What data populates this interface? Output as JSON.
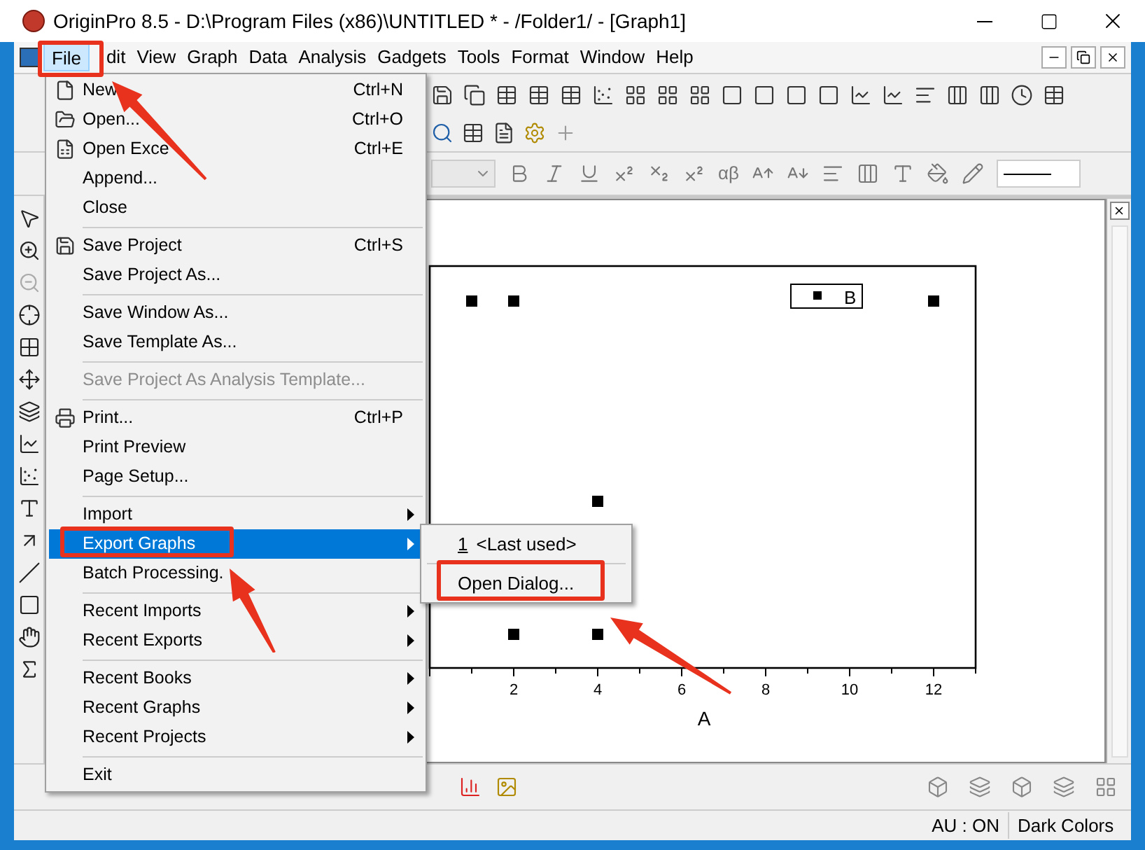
{
  "window": {
    "title": "OriginPro 8.5 - D:\\Program Files (x86)\\UNTITLED * - /Folder1/ - [Graph1]"
  },
  "menubar": [
    {
      "label": "File",
      "selected": true
    },
    {
      "label": "dit",
      "selected": false
    },
    {
      "label": "View",
      "selected": false
    },
    {
      "label": "Graph",
      "selected": false
    },
    {
      "label": "Data",
      "selected": false
    },
    {
      "label": "Analysis",
      "selected": false
    },
    {
      "label": "Gadgets",
      "selected": false
    },
    {
      "label": "Tools",
      "selected": false
    },
    {
      "label": "Format",
      "selected": false
    },
    {
      "label": "Window",
      "selected": false
    },
    {
      "label": "Help",
      "selected": false
    }
  ],
  "file_menu": [
    {
      "kind": "item",
      "label": "New",
      "shortcut": "Ctrl+N",
      "disabled": false,
      "has_submenu": false,
      "selected": false
    },
    {
      "kind": "item",
      "label": "Open...",
      "shortcut": "Ctrl+O",
      "disabled": false,
      "has_submenu": false,
      "selected": false
    },
    {
      "kind": "item",
      "label": "Open Exce",
      "shortcut": "Ctrl+E",
      "disabled": false,
      "has_submenu": false,
      "selected": false
    },
    {
      "kind": "item",
      "label": "Append...",
      "disabled": false,
      "has_submenu": false,
      "selected": false
    },
    {
      "kind": "item",
      "label": "Close",
      "disabled": false,
      "has_submenu": false,
      "selected": false
    },
    {
      "kind": "separator"
    },
    {
      "kind": "item",
      "label": "Save Project",
      "shortcut": "Ctrl+S",
      "disabled": false,
      "has_submenu": false,
      "selected": false
    },
    {
      "kind": "item",
      "label": "Save Project As...",
      "disabled": false,
      "has_submenu": false,
      "selected": false
    },
    {
      "kind": "separator"
    },
    {
      "kind": "item",
      "label": "Save Window As...",
      "disabled": false,
      "has_submenu": false,
      "selected": false
    },
    {
      "kind": "item",
      "label": "Save Template As...",
      "disabled": false,
      "has_submenu": false,
      "selected": false
    },
    {
      "kind": "separator"
    },
    {
      "kind": "item",
      "label": "Save Project As Analysis Template...",
      "disabled": true,
      "has_submenu": false,
      "selected": false
    },
    {
      "kind": "separator"
    },
    {
      "kind": "item",
      "label": "Print...",
      "shortcut": "Ctrl+P",
      "disabled": false,
      "has_submenu": false,
      "selected": false
    },
    {
      "kind": "item",
      "label": "Print Preview",
      "disabled": false,
      "has_submenu": false,
      "selected": false
    },
    {
      "kind": "item",
      "label": "Page Setup...",
      "disabled": false,
      "has_submenu": false,
      "selected": false
    },
    {
      "kind": "separator"
    },
    {
      "kind": "item",
      "label": "Import",
      "disabled": false,
      "has_submenu": true,
      "selected": false
    },
    {
      "kind": "item",
      "label": "Export Graphs",
      "disabled": false,
      "has_submenu": true,
      "selected": true
    },
    {
      "kind": "item",
      "label": "Batch Processing.",
      "disabled": false,
      "has_submenu": false,
      "selected": false
    },
    {
      "kind": "separator"
    },
    {
      "kind": "item",
      "label": "Recent Imports",
      "disabled": false,
      "has_submenu": true,
      "selected": false
    },
    {
      "kind": "item",
      "label": "Recent Exports",
      "disabled": false,
      "has_submenu": true,
      "selected": false
    },
    {
      "kind": "separator"
    },
    {
      "kind": "item",
      "label": "Recent Books",
      "disabled": false,
      "has_submenu": true,
      "selected": false
    },
    {
      "kind": "item",
      "label": "Recent Graphs",
      "disabled": false,
      "has_submenu": true,
      "selected": false
    },
    {
      "kind": "item",
      "label": "Recent Projects",
      "disabled": false,
      "has_submenu": true,
      "selected": false
    },
    {
      "kind": "separator"
    },
    {
      "kind": "item",
      "label": "Exit",
      "disabled": false,
      "has_submenu": false,
      "selected": false
    }
  ],
  "export_submenu": [
    {
      "kind": "item",
      "number": "1",
      "label": "<Last used>"
    },
    {
      "kind": "separator"
    },
    {
      "kind": "item",
      "label": "Open Dialog..."
    }
  ],
  "format_toolbar": {
    "greek_button": "αβ"
  },
  "graph": {
    "xticks": [
      "2",
      "4",
      "6",
      "8",
      "10",
      "12"
    ],
    "xlabel": "A",
    "legend": "B"
  },
  "status_bar": [
    "AU : ON",
    "Dark Colors"
  ]
}
